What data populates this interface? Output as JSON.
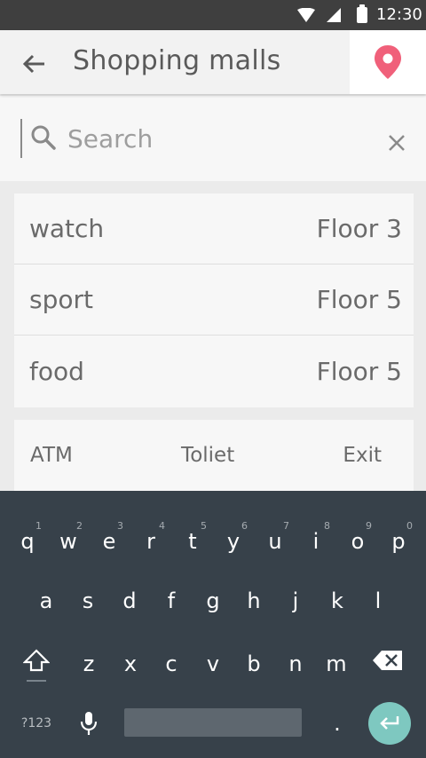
{
  "status_bar": {
    "time": "12:30"
  },
  "header": {
    "title": "Shopping malls"
  },
  "search": {
    "placeholder": "Search",
    "value": ""
  },
  "stores": [
    {
      "name": "watch",
      "floor": "Floor 3"
    },
    {
      "name": "sport",
      "floor": "Floor 5"
    },
    {
      "name": "food",
      "floor": "Floor 5"
    }
  ],
  "quick_tabs": [
    "ATM",
    "Toliet",
    "Exit"
  ],
  "colors": {
    "accent_pin": "#f0607a",
    "enter_key": "#7ec8c0",
    "keyboard_bg": "#37414a"
  },
  "keyboard": {
    "row1": [
      "q",
      "w",
      "e",
      "r",
      "t",
      "y",
      "u",
      "i",
      "o",
      "p"
    ],
    "row1_hints": [
      "1",
      "2",
      "3",
      "4",
      "5",
      "6",
      "7",
      "8",
      "9",
      "0"
    ],
    "row2": [
      "a",
      "s",
      "d",
      "f",
      "g",
      "h",
      "j",
      "k",
      "l"
    ],
    "row3": [
      "z",
      "x",
      "c",
      "v",
      "b",
      "n",
      "m"
    ],
    "symbols_label": "?123",
    "period_label": "."
  }
}
